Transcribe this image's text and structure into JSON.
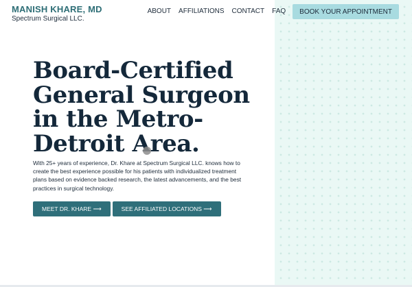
{
  "brand": {
    "name": "MANISH KHARE, MD",
    "subtitle": "Spectrum Surgical LLC."
  },
  "nav": {
    "items": [
      "ABOUT",
      "AFFILIATIONS",
      "CONTACT",
      "FAQ"
    ],
    "book_button": "BOOK YOUR APPOINTMENT"
  },
  "hero": {
    "title": "Board-Certified General Surgeon in the Metro-Detroit Area.",
    "description": "With 25+ years of experience, Dr. Khare at Spectrum Surgical LLC. knows how to create the best experience possible for his patients with individualized treatment plans based on evidence backed research, the latest advancements, and the best practices in surgical technology.",
    "buttons": [
      "MEET DR. KHARE ⟶",
      "SEE AFFILIATED LOCATIONS ⟶"
    ]
  },
  "colors": {
    "brand": "#2e6e76",
    "primary_button": "#2f6f7a",
    "book_button": "#a8dbe0",
    "pattern_bg": "#eaf8f5",
    "heading": "#14283a"
  }
}
